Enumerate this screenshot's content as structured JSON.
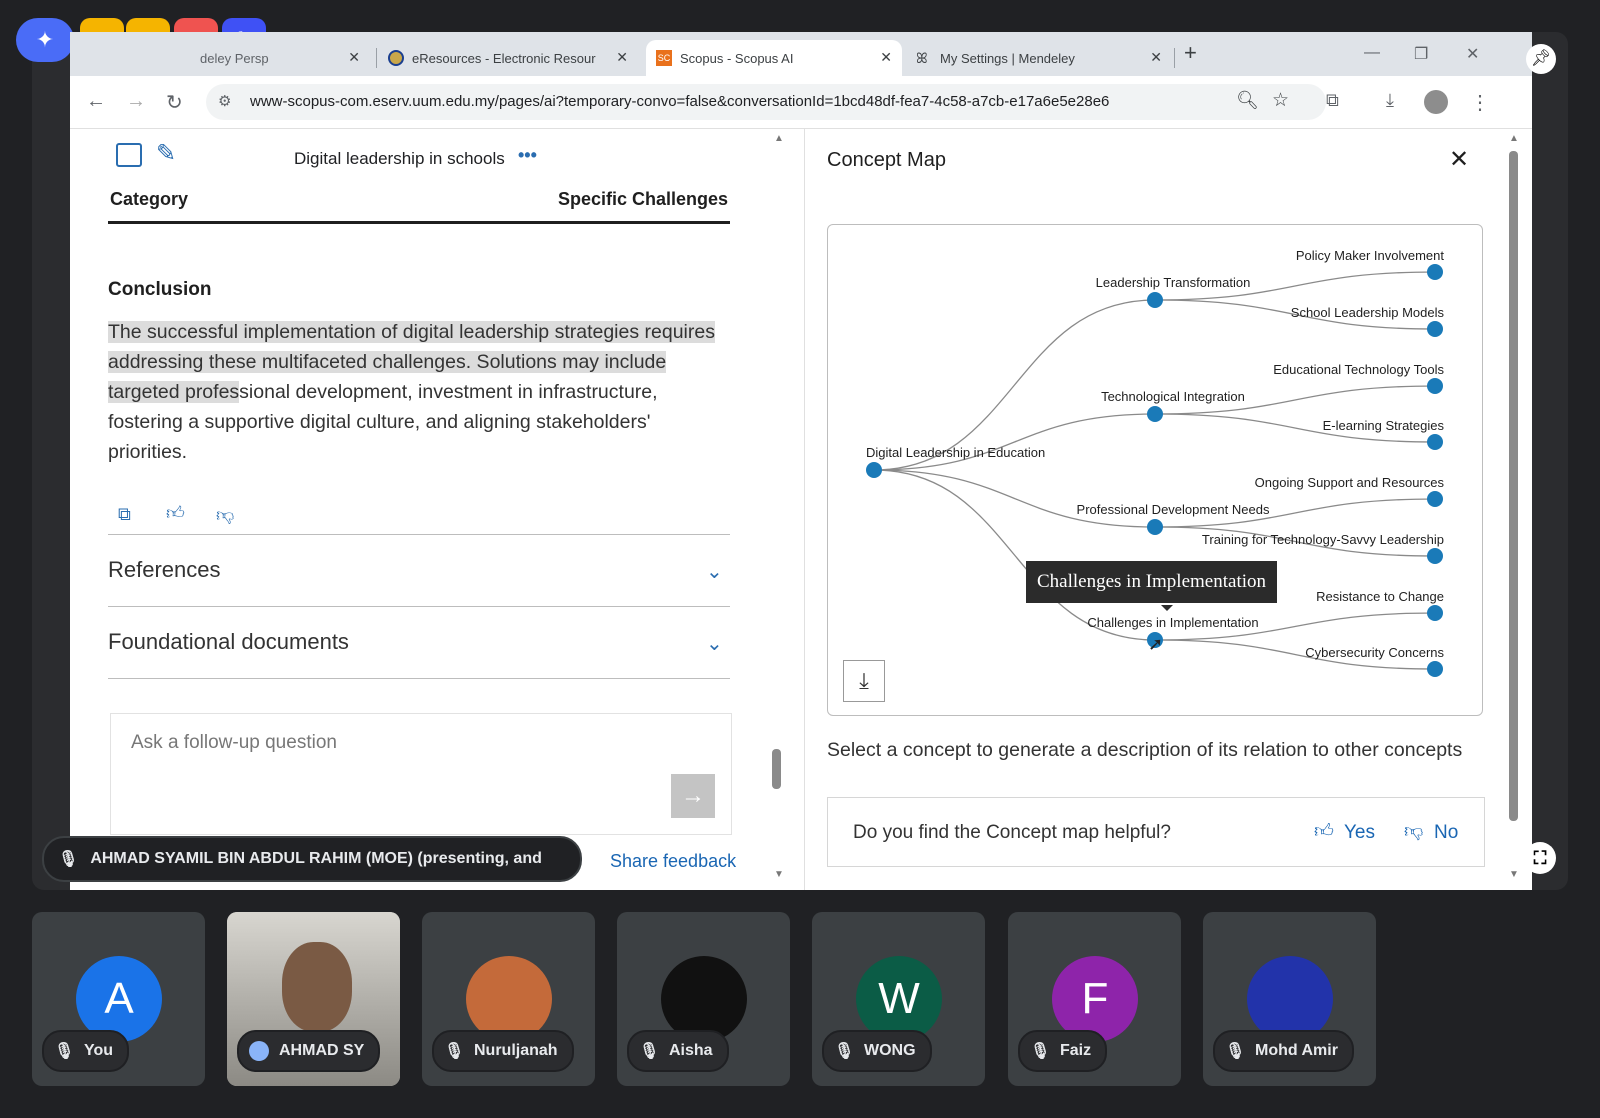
{
  "browser": {
    "tabs": [
      {
        "label": "deley Persp",
        "active": false
      },
      {
        "label": "eResources - Electronic Resour",
        "active": false
      },
      {
        "label": "Scopus - Scopus AI",
        "active": true
      },
      {
        "label": "My Settings | Mendeley",
        "active": false
      }
    ],
    "new_tab": "+",
    "url": "www-scopus-com.eserv.uum.edu.my/pages/ai?temporary-convo=false&conversationId=1bcd48df-fea7-4c58-a7cb-e17a6e5e28e6",
    "scopus_fav_text": "SC"
  },
  "left": {
    "conversation_title": "Digital leadership in schools",
    "more": "•••",
    "table_headers": [
      "Category",
      "Specific Challenges"
    ],
    "conclusion_heading": "Conclusion",
    "conclusion_highlight": "The successful implementation of digital leadership strategies requires addressing these multifaceted challenges. Solutions may include targeted profes",
    "conclusion_rest": "sional development, investment in infrastructure, fostering a supportive digital culture, and aligning stakeholders' priorities.",
    "references": "References",
    "foundational": "Foundational documents",
    "followup_placeholder": "Ask a follow-up question",
    "share_feedback": "Share feedback"
  },
  "concept_map": {
    "title": "Concept Map",
    "root": "Digital Leadership in Education",
    "branches": [
      {
        "label": "Leadership Transformation",
        "children": [
          "Policy Maker Involvement",
          "School Leadership Models"
        ]
      },
      {
        "label": "Technological Integration",
        "children": [
          "Educational Technology Tools",
          "E-learning Strategies"
        ]
      },
      {
        "label": "Professional Development Needs",
        "children": [
          "Ongoing Support and Resources",
          "Training for Technology-Savvy Leadership"
        ]
      },
      {
        "label": "Challenges in Implementation",
        "children": [
          "Resistance to Change",
          "Cybersecurity Concerns"
        ]
      }
    ],
    "tooltip": "Challenges in Implementation",
    "hint": "Select a concept to generate a description of its relation to other concepts",
    "helpful_question": "Do you find the Concept map helpful?",
    "yes": "Yes",
    "no": "No",
    "node_color": "#1a7ab8"
  },
  "meeting": {
    "presenter_banner": "AHMAD SYAMIL BIN ABDUL RAHIM (MOE) (presenting, and",
    "participants": [
      {
        "name": "You",
        "initial": "A",
        "color": "#1a73e8"
      },
      {
        "name": "AHMAD SY",
        "initial": "",
        "color": "#5f6368"
      },
      {
        "name": "Nuruljanah",
        "initial": "",
        "color": "#c46a3a"
      },
      {
        "name": "Aisha",
        "initial": "",
        "color": "#111111"
      },
      {
        "name": "WONG",
        "initial": "W",
        "color": "#0b5c46"
      },
      {
        "name": "Faiz",
        "initial": "F",
        "color": "#8e24aa"
      },
      {
        "name": "Mohd Amir",
        "initial": "",
        "color": "#2233aa"
      }
    ]
  }
}
